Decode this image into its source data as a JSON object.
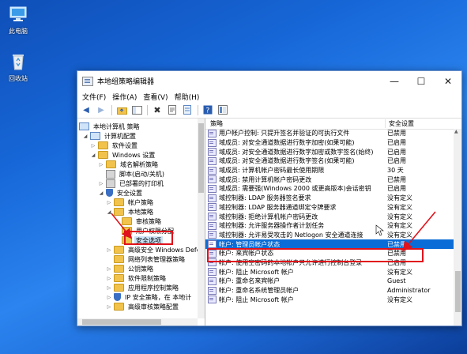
{
  "desktop": {
    "icons": [
      {
        "label": "此电脑"
      },
      {
        "label": "回收站"
      }
    ]
  },
  "window": {
    "title": "本地组策略编辑器",
    "controls": {
      "minimize": "—",
      "maximize": "☐",
      "close": "✕"
    }
  },
  "menu": [
    "文件(F)",
    "操作(A)",
    "查看(V)",
    "帮助(H)"
  ],
  "tree": [
    {
      "label": "本地计算机 策略"
    },
    {
      "label": "计算机配置"
    },
    {
      "label": "软件设置"
    },
    {
      "label": "Windows 设置"
    },
    {
      "label": "域名解析策略"
    },
    {
      "label": "脚本(启动/关机)"
    },
    {
      "label": "已部署的打印机"
    },
    {
      "label": "安全设置"
    },
    {
      "label": "帐户策略"
    },
    {
      "label": "本地策略"
    },
    {
      "label": "审核策略"
    },
    {
      "label": "用户权限分配"
    },
    {
      "label": "安全选项"
    },
    {
      "label": "高级安全 Windows Defe"
    },
    {
      "label": "网络列表管理器策略"
    },
    {
      "label": "公钥策略"
    },
    {
      "label": "软件限制策略"
    },
    {
      "label": "应用程序控制策略"
    },
    {
      "label": "IP 安全策略，在 本地计"
    },
    {
      "label": "高级审核策略配置"
    }
  ],
  "list": {
    "columns": {
      "policy": "策略",
      "setting": "安全设置"
    },
    "rows": [
      {
        "policy": "用户帐户控制: 只提升签名并验证的可执行文件",
        "setting": "已禁用"
      },
      {
        "policy": "域成员: 对安全通道数据进行数字加密(如果可能)",
        "setting": "已启用"
      },
      {
        "policy": "域成员: 对安全通道数据进行数字加密或数字签名(始终)",
        "setting": "已启用"
      },
      {
        "policy": "域成员: 对安全通道数据进行数字签名(如果可能)",
        "setting": "已启用"
      },
      {
        "policy": "域成员: 计算机帐户密码最长使用期限",
        "setting": "30 天"
      },
      {
        "policy": "域成员: 禁用计算机帐户密码更改",
        "setting": "已禁用"
      },
      {
        "policy": "域成员: 需要强(Windows 2000 或更高版本)会话密钥",
        "setting": "已启用"
      },
      {
        "policy": "域控制器: LDAP 服务器签名要求",
        "setting": "没有定义"
      },
      {
        "policy": "域控制器: LDAP 服务器通道绑定令牌要求",
        "setting": "没有定义"
      },
      {
        "policy": "域控制器: 拒绝计算机帐户密码更改",
        "setting": "没有定义"
      },
      {
        "policy": "域控制器: 允许服务器操作者计划任务",
        "setting": "没有定义"
      },
      {
        "policy": "域控制器: 允许易受攻击的 Netlogon 安全通道连接",
        "setting": "没有定义"
      },
      {
        "policy": "帐户: 管理员帐户状态",
        "setting": "已禁用"
      },
      {
        "policy": "帐户: 来宾帐户状态",
        "setting": "已禁用"
      },
      {
        "policy": "帐户: 使用空密码的本地帐户只允许进行控制台登录",
        "setting": "已启用"
      },
      {
        "policy": "帐户: 阻止 Microsoft 帐户",
        "setting": "没有定义"
      },
      {
        "policy": "帐户: 重命名来宾帐户",
        "setting": "Guest"
      },
      {
        "policy": "帐户: 重命名系统管理员帐户",
        "setting": "Administrator"
      },
      {
        "policy": "帐户: 阻止 Microsoft 帐户",
        "setting": "没有定义"
      }
    ]
  }
}
